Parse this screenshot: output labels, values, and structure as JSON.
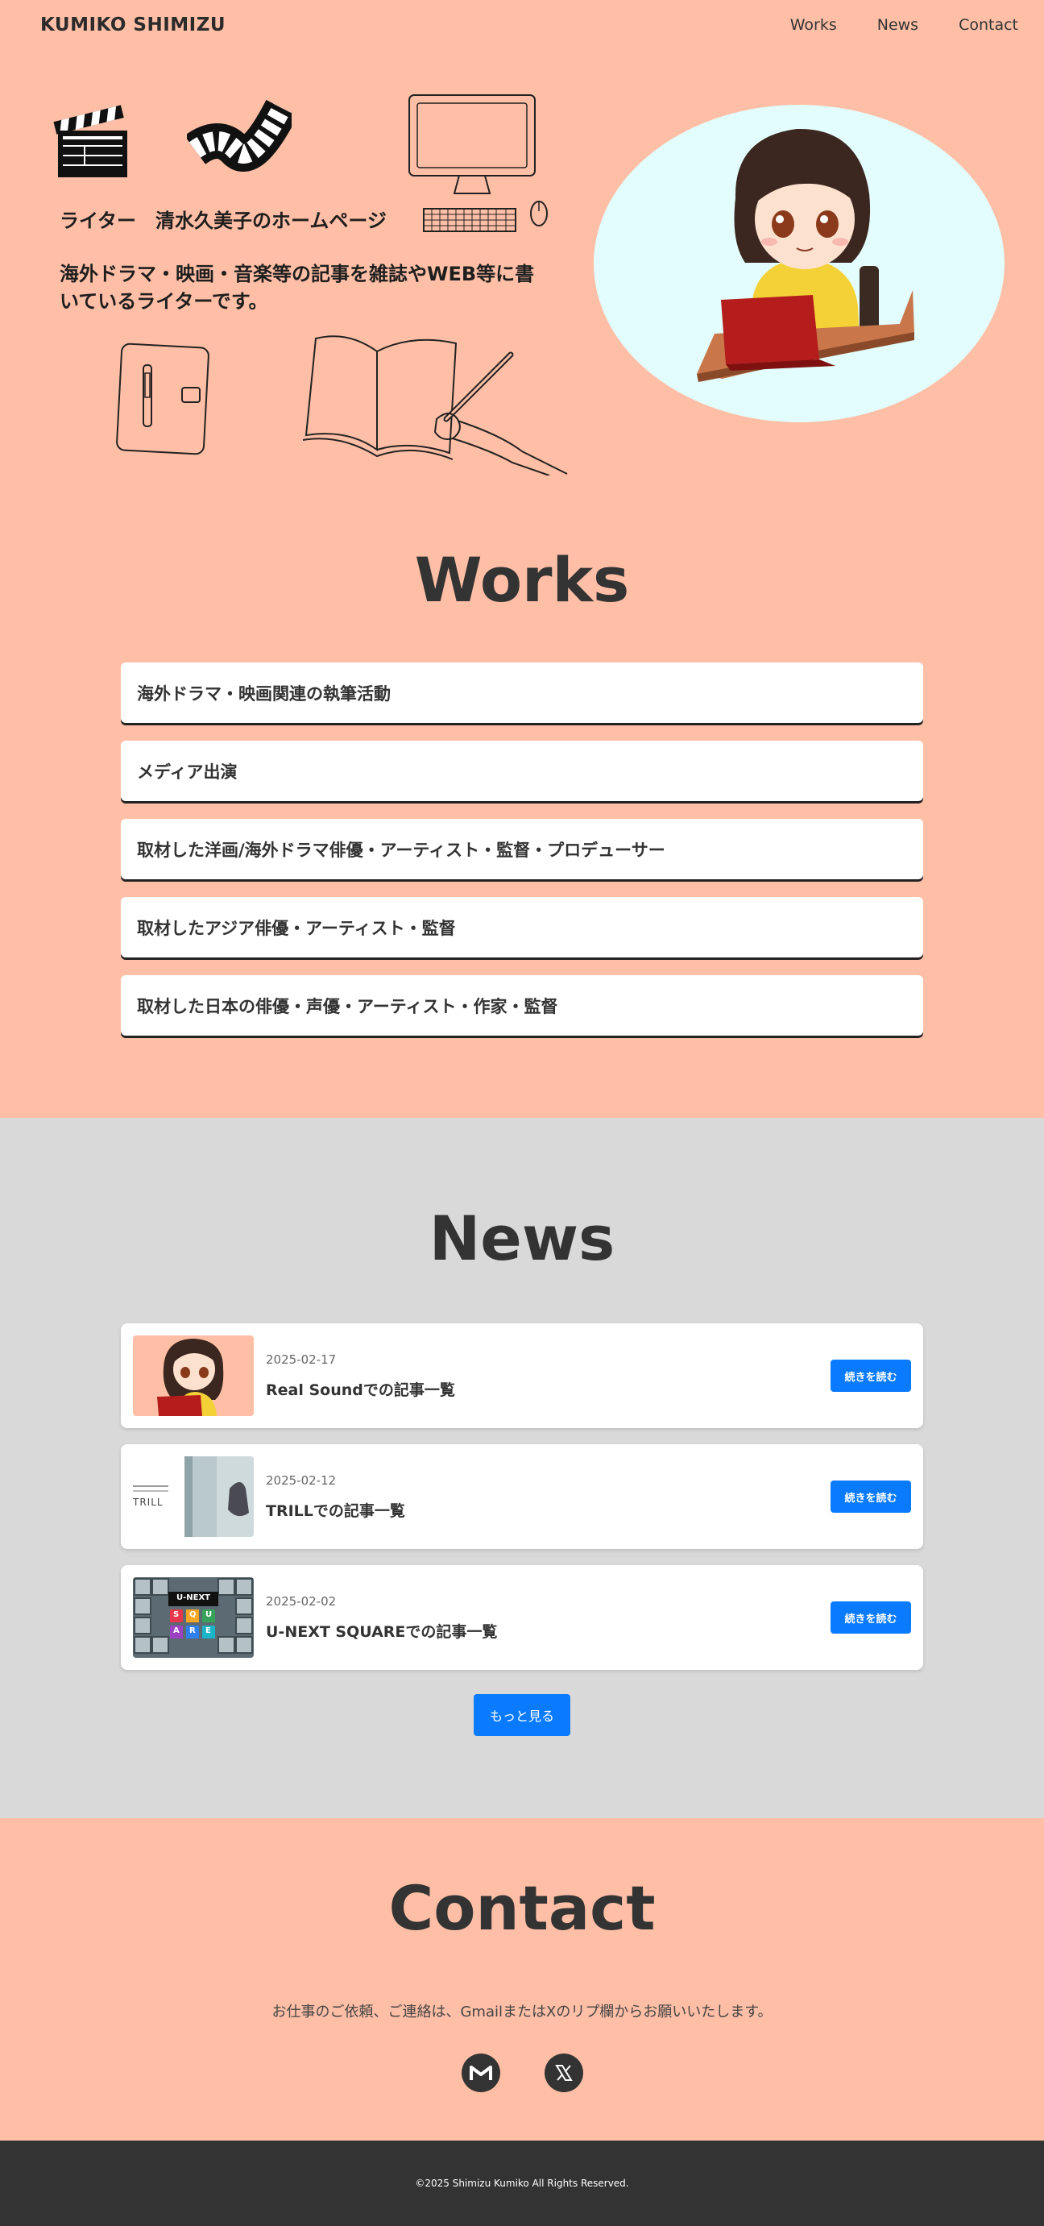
{
  "header": {
    "brand": "KUMIKO SHIMIZU",
    "nav": [
      "Works",
      "News",
      "Contact"
    ]
  },
  "hero": {
    "title": "ライター　清水久美子のホームページ",
    "description": "海外ドラマ・映画・音楽等の記事を雑誌やWEB等に書いているライターです。"
  },
  "works": {
    "title": "Works",
    "items": [
      "海外ドラマ・映画関連の執筆活動",
      "メディア出演",
      "取材した洋画/海外ドラマ俳優・アーティスト・監督・プロデューサー",
      "取材したアジア俳優・アーティスト・監督",
      "取材した日本の俳優・声優・アーティスト・作家・監督"
    ]
  },
  "news": {
    "title": "News",
    "items": [
      {
        "date": "2025-02-17",
        "title": "Real Soundでの記事一覧",
        "button": "続きを読む"
      },
      {
        "date": "2025-02-12",
        "title": "TRILLでの記事一覧",
        "button": "続きを読む",
        "thumb_text": "TRILL"
      },
      {
        "date": "2025-02-02",
        "title": "U-NEXT SQUAREでの記事一覧",
        "button": "続きを読む",
        "thumb_logo": "U-NEXT",
        "thumb_letters": [
          "S",
          "Q",
          "U",
          "A",
          "R",
          "E"
        ]
      }
    ],
    "more_label": "もっと見る"
  },
  "contact": {
    "title": "Contact",
    "text": "お仕事のご依頼、ご連絡は、GmailまたはXのリプ欄からお願いいたします。",
    "icons": [
      "gmail-icon",
      "x-icon"
    ]
  },
  "footer": {
    "copyright": "©2025 Shimizu Kumiko All Rights Reserved."
  },
  "colors": {
    "background": "#ffbfa6",
    "news_background": "#d9d9d9",
    "accent": "#0a7bff",
    "footer": "#333333"
  }
}
